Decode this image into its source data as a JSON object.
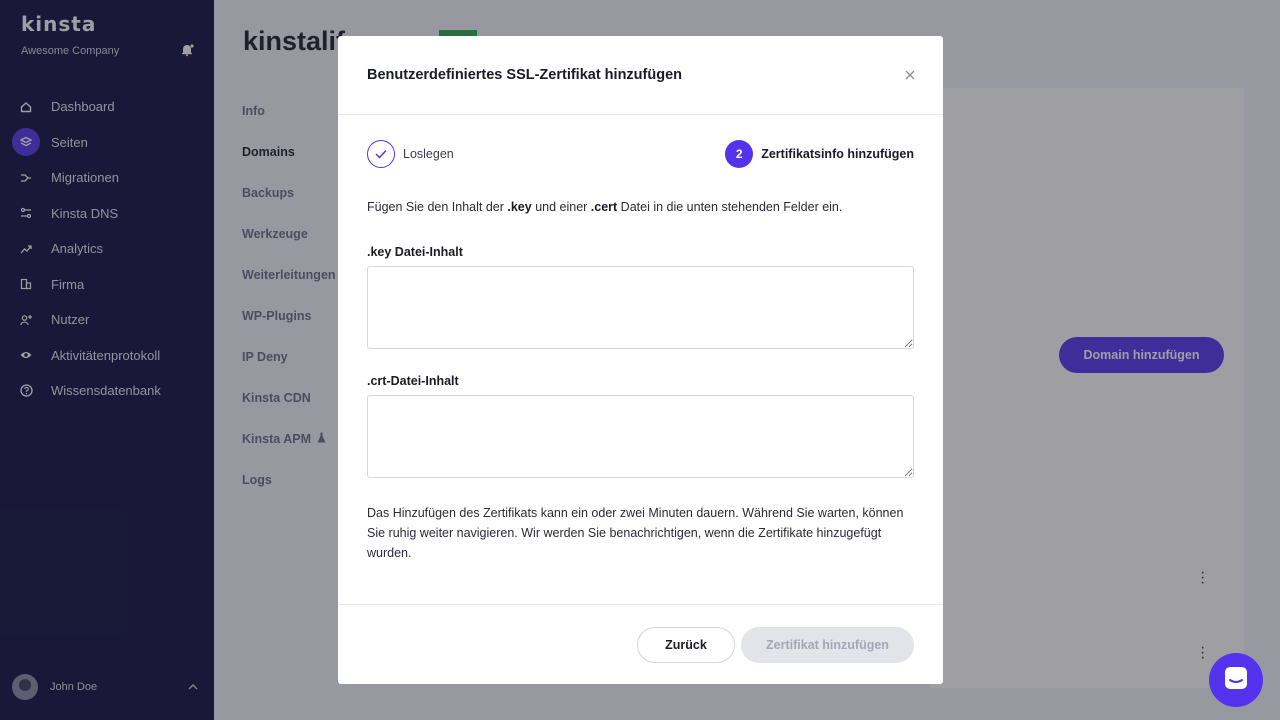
{
  "sidebar": {
    "logo": "kinsta",
    "company": "Awesome Company",
    "items": [
      {
        "label": "Dashboard",
        "icon": "home-icon"
      },
      {
        "label": "Seiten",
        "icon": "layers-icon"
      },
      {
        "label": "Migrationen",
        "icon": "migration-icon"
      },
      {
        "label": "Kinsta DNS",
        "icon": "dns-icon"
      },
      {
        "label": "Analytics",
        "icon": "trend-icon"
      },
      {
        "label": "Firma",
        "icon": "building-icon"
      },
      {
        "label": "Nutzer",
        "icon": "add-user-icon"
      },
      {
        "label": "Aktivitätenprotokoll",
        "icon": "eye-icon"
      },
      {
        "label": "Wissensdatenbank",
        "icon": "help-icon"
      }
    ],
    "active_index": 1,
    "user": {
      "name": "John Doe"
    }
  },
  "main": {
    "site_title": "kinstalif",
    "subnav": [
      "Info",
      "Domains",
      "Backups",
      "Werkzeuge",
      "Weiterleitungen",
      "WP-Plugins",
      "IP Deny",
      "Kinsta CDN",
      "Kinsta APM",
      "Logs"
    ],
    "subnav_active_index": 1,
    "add_domain_label": "Domain hinzufügen"
  },
  "modal": {
    "title": "Benutzerdefiniertes SSL-Zertifikat hinzufügen",
    "step1_label": "Loslegen",
    "step2_number": "2",
    "step2_label": "Zertifikatsinfo hinzufügen",
    "intro_prefix": "Fügen Sie den Inhalt der ",
    "intro_key": ".key",
    "intro_middle": " und einer ",
    "intro_cert": ".cert",
    "intro_suffix": " Datei in die unten stehenden Felder ein.",
    "key_label": ".key Datei-Inhalt",
    "key_value": "",
    "crt_label": ".crt-Datei-Inhalt",
    "crt_value": "",
    "note": "Das Hinzufügen des Zertifikats kann ein oder zwei Minuten dauern. Während Sie warten, können Sie ruhig weiter navigieren. Wir werden Sie benachrichtigen, wenn die Zertifikate hinzugefügt wurden.",
    "back_label": "Zurück",
    "submit_label": "Zertifikat hinzufügen"
  },
  "colors": {
    "sidebar_bg": "#0d0c3d",
    "accent": "#5333ed",
    "badge_green": "#2aa84a"
  }
}
